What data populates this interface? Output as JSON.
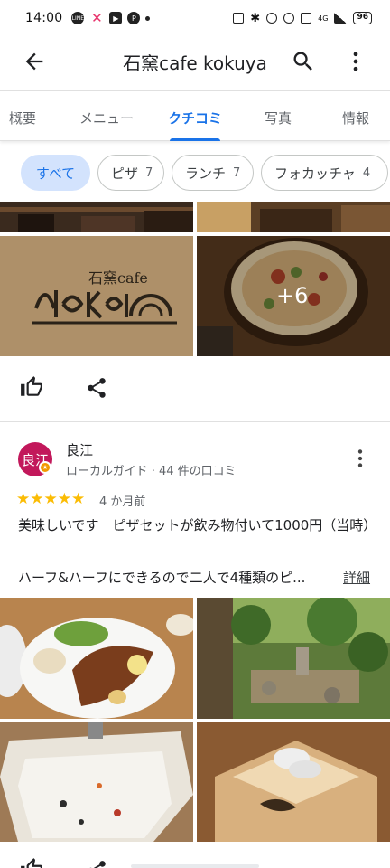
{
  "status_bar": {
    "time": "14:00",
    "battery": "96",
    "network": "4G"
  },
  "app_bar": {
    "title": "石窯cafe kokuya"
  },
  "tabs": [
    {
      "label": "概要"
    },
    {
      "label": "メニュー"
    },
    {
      "label": "クチコミ",
      "active": true
    },
    {
      "label": "写真"
    },
    {
      "label": "情報"
    }
  ],
  "chips": [
    {
      "label": "すべて",
      "count": "",
      "active": true
    },
    {
      "label": "ピザ",
      "count": "7"
    },
    {
      "label": "ランチ",
      "count": "7"
    },
    {
      "label": "フォカッチャ",
      "count": "4"
    }
  ],
  "photos_top": {
    "more_count": "+6"
  },
  "review": {
    "avatar_text": "良江",
    "name": "良江",
    "meta": "ローカルガイド · 44 件の口コミ",
    "stars": "★★★★★",
    "age": "4 か月前",
    "text_line1": "美味しいです　ピザセットが飲み物付いて1000円（当時）",
    "text_line3": "ハーフ&ハーフにできるので二人で4種類のピ...",
    "more_label": "詳細"
  },
  "colors": {
    "accent": "#1a73e8",
    "chip_active_bg": "#d3e3fd",
    "star": "#fbbc04",
    "avatar": "#c2185b"
  },
  "icons": [
    "back-arrow-icon",
    "search-icon",
    "more-vert-icon",
    "thumb-up-icon",
    "share-icon"
  ]
}
